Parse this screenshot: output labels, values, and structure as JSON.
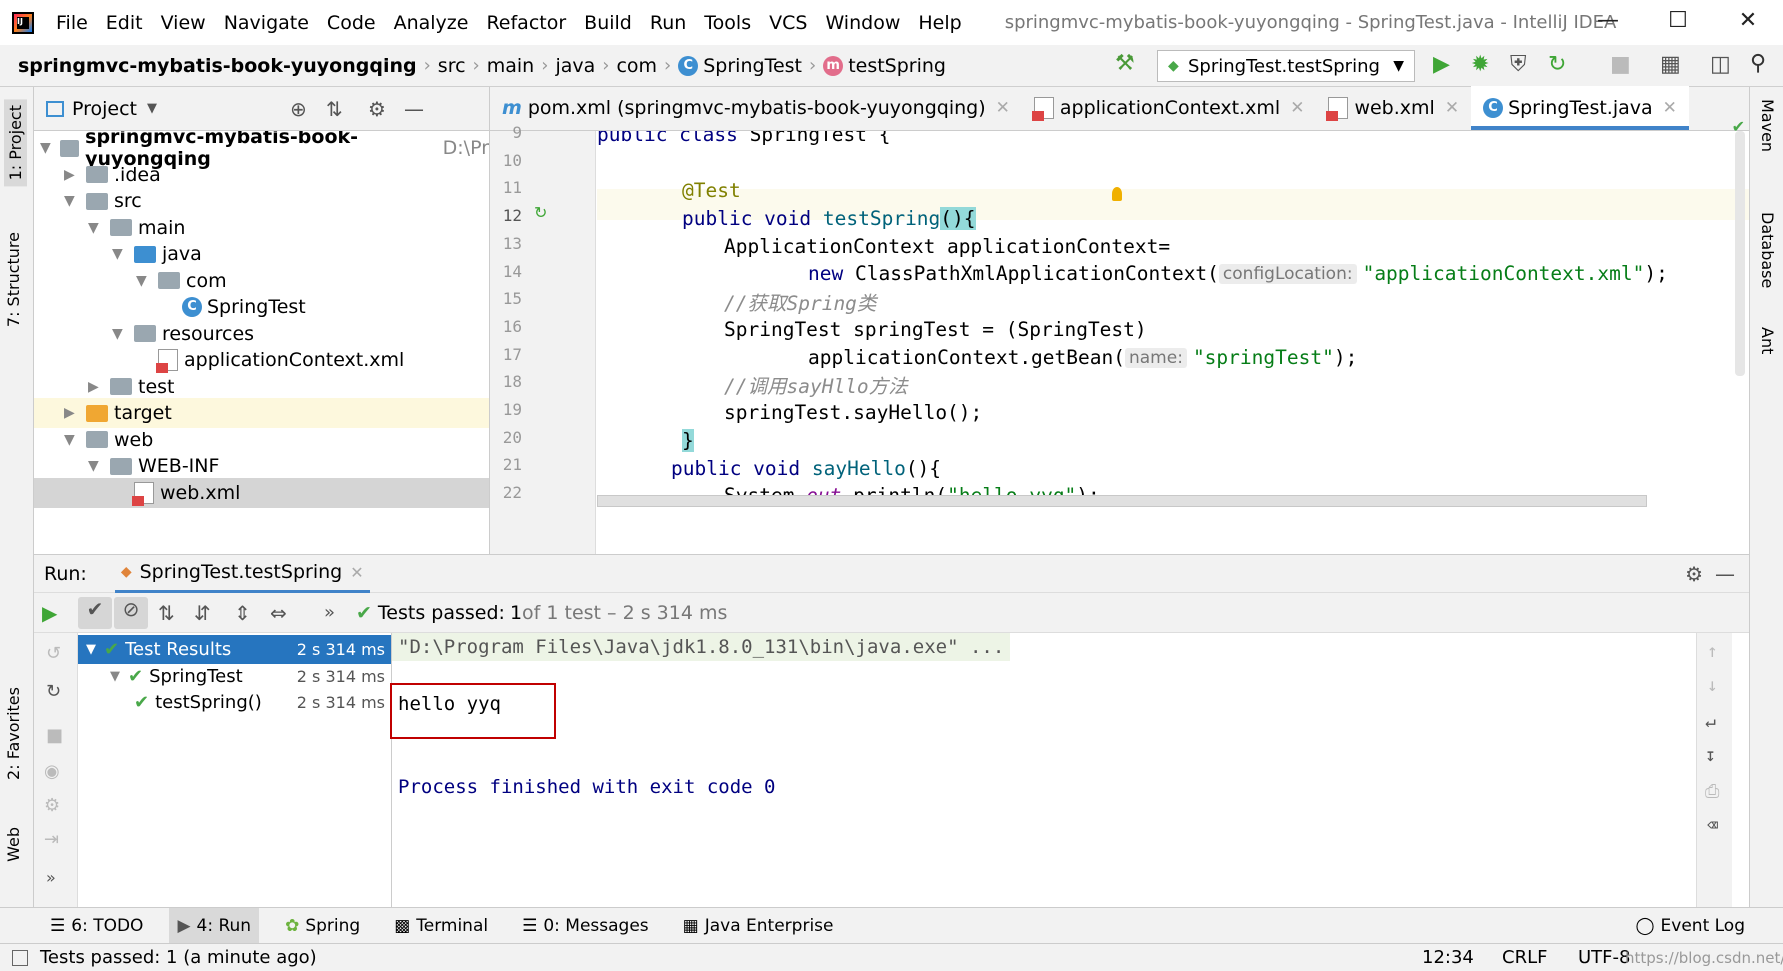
{
  "titlebar": {
    "menus": [
      "File",
      "Edit",
      "View",
      "Navigate",
      "Code",
      "Analyze",
      "Refactor",
      "Build",
      "Run",
      "Tools",
      "VCS",
      "Window",
      "Help"
    ],
    "window_title": "springmvc-mybatis-book-yuyongqing - SpringTest.java - IntelliJ IDEA"
  },
  "navbar": {
    "crumbs": [
      "springmvc-mybatis-book-yuyongqing",
      "src",
      "main",
      "java",
      "com",
      "SpringTest",
      "testSpring"
    ],
    "run_config": "SpringTest.testSpring"
  },
  "left_strip": {
    "project": "1: Project",
    "structure": "7: Structure",
    "favorites": "2: Favorites",
    "web": "Web"
  },
  "right_strip": {
    "maven": "Maven",
    "database": "Database",
    "ant": "Ant"
  },
  "project_panel": {
    "title": "Project",
    "root_path": "D:\\Pr",
    "tree": [
      {
        "label": "springmvc-mybatis-book-yuyongqing",
        "level": 0,
        "expanded": true,
        "kind": "module"
      },
      {
        "label": ".idea",
        "level": 1,
        "expanded": false,
        "kind": "folder"
      },
      {
        "label": "src",
        "level": 1,
        "expanded": true,
        "kind": "folder"
      },
      {
        "label": "main",
        "level": 2,
        "expanded": true,
        "kind": "folder"
      },
      {
        "label": "java",
        "level": 3,
        "expanded": true,
        "kind": "source"
      },
      {
        "label": "com",
        "level": 4,
        "expanded": true,
        "kind": "folder"
      },
      {
        "label": "SpringTest",
        "level": 5,
        "kind": "class"
      },
      {
        "label": "resources",
        "level": 3,
        "expanded": true,
        "kind": "folder"
      },
      {
        "label": "applicationContext.xml",
        "level": 4,
        "kind": "xml"
      },
      {
        "label": "test",
        "level": 2,
        "expanded": false,
        "kind": "folder"
      },
      {
        "label": "target",
        "level": 1,
        "expanded": false,
        "kind": "excluded"
      },
      {
        "label": "web",
        "level": 1,
        "expanded": true,
        "kind": "web"
      },
      {
        "label": "WEB-INF",
        "level": 2,
        "expanded": true,
        "kind": "folder"
      },
      {
        "label": "web.xml",
        "level": 3,
        "kind": "xml",
        "selected": true
      }
    ]
  },
  "editor": {
    "tabs": [
      {
        "label": "pom.xml (springmvc-mybatis-book-yuyongqing)",
        "icon": "m"
      },
      {
        "label": "applicationContext.xml",
        "icon": "xml"
      },
      {
        "label": "web.xml",
        "icon": "xml"
      },
      {
        "label": "SpringTest.java",
        "icon": "c",
        "active": true
      }
    ],
    "line_numbers": [
      "9",
      "10",
      "11",
      "12",
      "13",
      "14",
      "15",
      "16",
      "17",
      "18",
      "19",
      "20",
      "21",
      "22"
    ],
    "code": {
      "l9_kw": "public class ",
      "l9_rest": "SpringTest {",
      "l11_annot": "@Test",
      "l12_kw": "public void ",
      "l12_fn": "testSpring",
      "l12_rest": "(){",
      "l13": "ApplicationContext applicationContext=",
      "l14_kw": "new ",
      "l14_cls": "ClassPathXmlApplicationContext(",
      "l14_hint": "configLocation:",
      "l14_str": "\"applicationContext.xml\"",
      "l14_end": ");",
      "l15": "//获取Spring类",
      "l16": "SpringTest springTest = (SpringTest)",
      "l17_pre": "applicationContext.getBean(",
      "l17_hint": "name:",
      "l17_str": "\"springTest\"",
      "l17_end": ");",
      "l18": "//调用sayHllo方法",
      "l19": "springTest.sayHello();",
      "l20": "}",
      "l21_kw": "public void ",
      "l21_fn": "sayHello",
      "l21_rest": "(){",
      "l22_pre": "System.",
      "l22_out": "out",
      "l22_mid": ".println(",
      "l22_str": "\"hello yyq\"",
      "l22_end": ");"
    }
  },
  "run_panel": {
    "label": "Run:",
    "tab": "SpringTest.testSpring",
    "summary_prefix": "Tests passed: ",
    "summary_count": "1",
    "summary_rest": " of 1 test – 2 s 314 ms",
    "tree": [
      {
        "label": "Test Results",
        "time": "2 s 314 ms",
        "level": 0,
        "selected": true
      },
      {
        "label": "SpringTest",
        "time": "2 s 314 ms",
        "level": 1
      },
      {
        "label": "testSpring()",
        "time": "2 s 314 ms",
        "level": 2
      }
    ],
    "console": {
      "cmd": "\"D:\\Program Files\\Java\\jdk1.8.0_131\\bin\\java.exe\" ...",
      "output": "hello yyq",
      "exit": "Process finished with exit code 0"
    }
  },
  "tool_windows": [
    "6: TODO",
    "4: Run",
    "Spring",
    "Terminal",
    "0: Messages",
    "Java Enterprise"
  ],
  "event_log": "Event Log",
  "status": {
    "message": "Tests passed: 1 (a minute ago)",
    "position": "12:34",
    "line_sep": "CRLF",
    "encoding": "UTF-8",
    "watermark": "https://blog.csdn.net/Yudik"
  }
}
